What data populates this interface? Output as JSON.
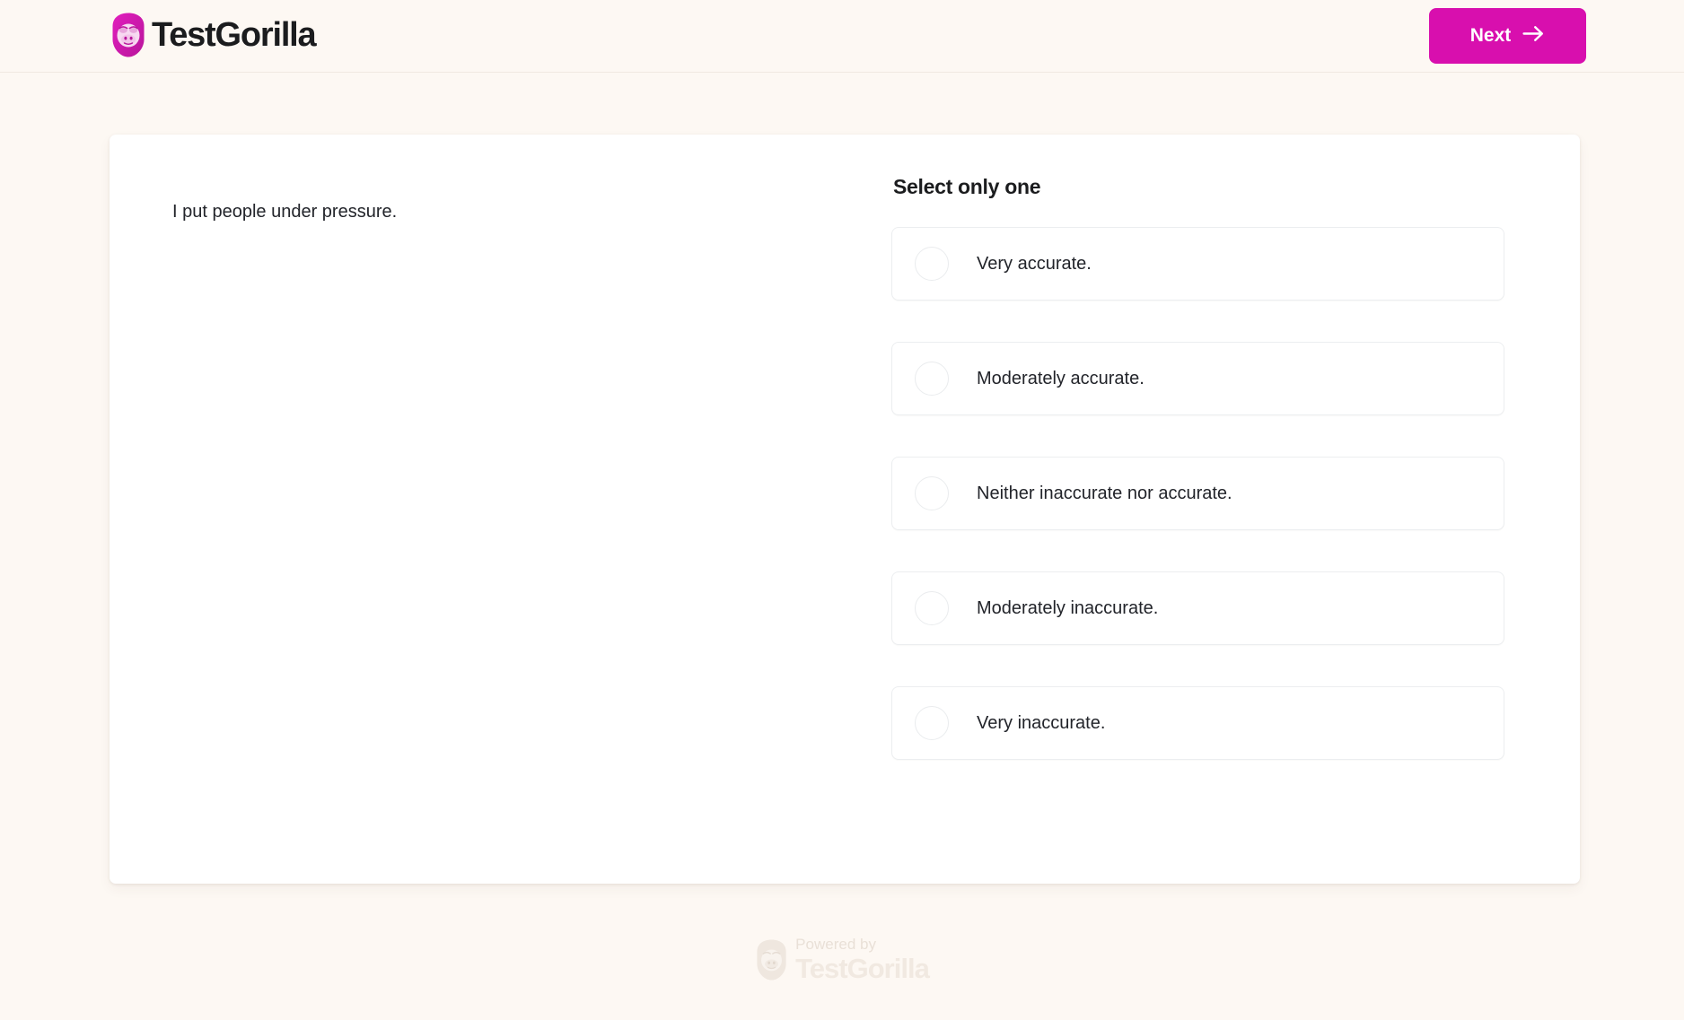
{
  "header": {
    "logo_text": "TestGorilla",
    "logo_icon": "gorilla-head-icon",
    "next_label": "Next",
    "next_icon": "arrow-right-icon",
    "accent_color": "#d80fae",
    "background_color": "#fdf8f3"
  },
  "main": {
    "question": "I put people under pressure.",
    "answers_heading": "Select only one",
    "options": [
      {
        "label": "Very accurate.",
        "selected": false
      },
      {
        "label": "Moderately accurate.",
        "selected": false
      },
      {
        "label": "Neither inaccurate nor accurate.",
        "selected": false
      },
      {
        "label": "Moderately inaccurate.",
        "selected": false
      },
      {
        "label": "Very inaccurate.",
        "selected": false
      }
    ]
  },
  "footer": {
    "powered_by": "Powered by",
    "brand": "TestGorilla",
    "icon": "gorilla-head-icon"
  }
}
